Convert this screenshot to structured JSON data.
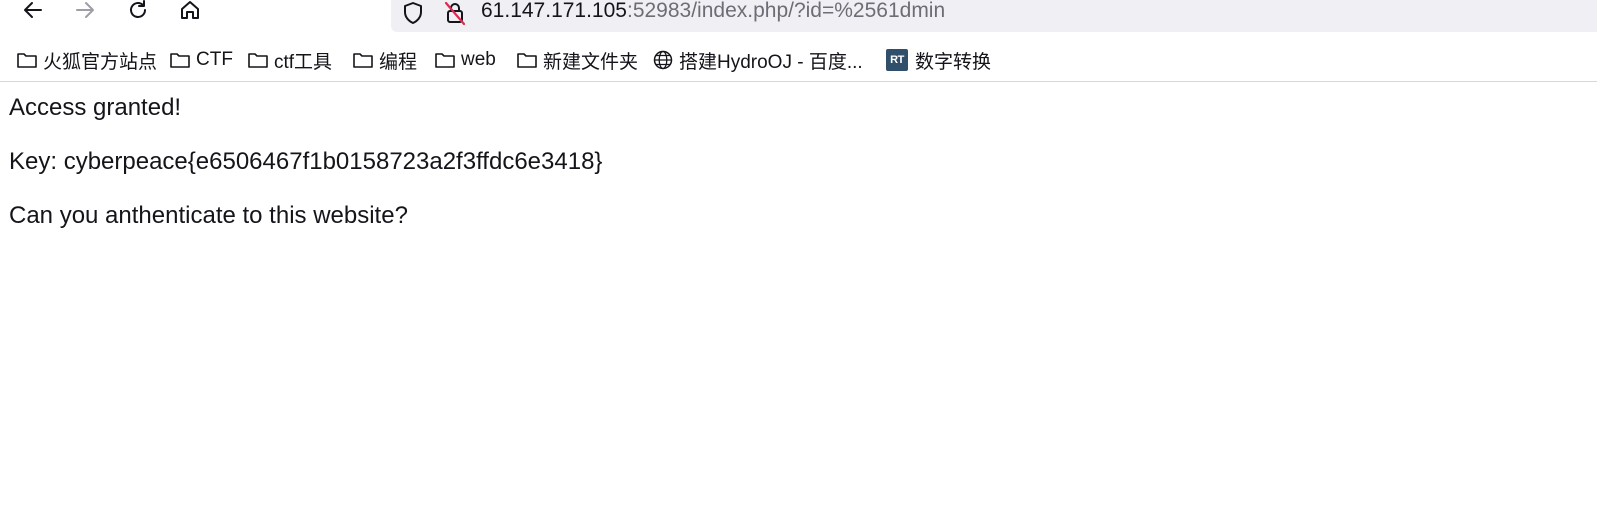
{
  "browser": {
    "url_host": "61.147.171.105",
    "url_rest": ":52983/index.php/?id=%2561dmin",
    "icons": [
      "back-icon",
      "forward-icon",
      "reload-icon",
      "home-icon",
      "shield-icon",
      "insecure-lock-icon"
    ]
  },
  "bookmarks": [
    {
      "label": "火狐官方站点",
      "icon": "folder-icon"
    },
    {
      "label": "CTF",
      "icon": "folder-icon"
    },
    {
      "label": "ctf工具",
      "icon": "folder-icon"
    },
    {
      "label": "编程",
      "icon": "folder-icon"
    },
    {
      "label": "web",
      "icon": "folder-icon"
    },
    {
      "label": "新建文件夹",
      "icon": "folder-icon"
    },
    {
      "label": "搭建HydroOJ - 百度...",
      "icon": "globe-icon"
    },
    {
      "label": "数字转换",
      "icon": "rt-icon",
      "icon_text": "RT"
    }
  ],
  "page": {
    "line1": "Access granted!",
    "line2": "Key: cyberpeace{e6506467f1b0158723a2f3ffdc6e3418}",
    "line3": "Can you anthenticate to this website?"
  }
}
